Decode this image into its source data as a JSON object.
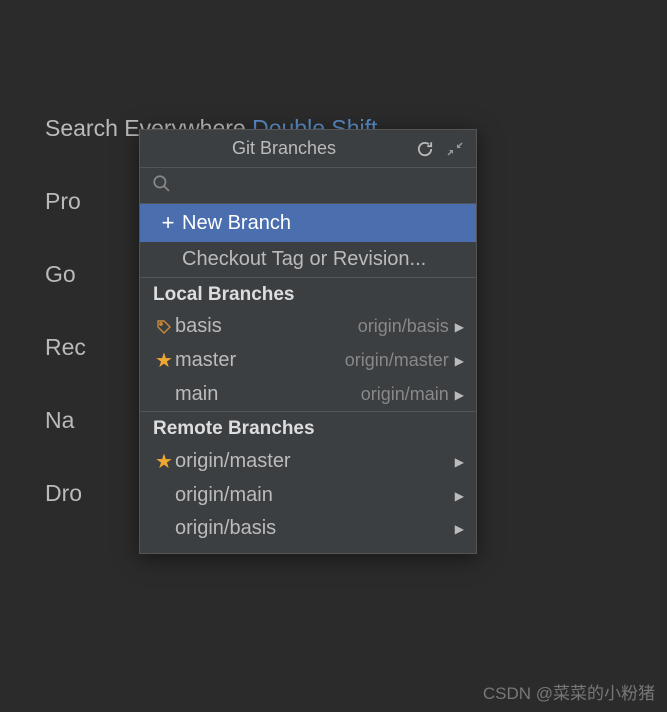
{
  "background": {
    "line1": {
      "text": "Search Everywhere",
      "shortcut": "Double Shift"
    },
    "line2": "Pro",
    "line3": "Go",
    "line4": "Rec",
    "line5": "Na",
    "line6": "Dro"
  },
  "popup": {
    "title": "Git Branches",
    "search_placeholder": "",
    "actions": {
      "new_branch": "New Branch",
      "checkout_tag": "Checkout Tag or Revision..."
    },
    "local_section": "Local Branches",
    "local_branches": [
      {
        "name": "basis",
        "tracking": "origin/basis",
        "icon": "tag"
      },
      {
        "name": "master",
        "tracking": "origin/master",
        "icon": "star"
      },
      {
        "name": "main",
        "tracking": "origin/main",
        "icon": ""
      }
    ],
    "remote_section": "Remote Branches",
    "remote_branches": [
      {
        "name": "origin/master",
        "icon": "star"
      },
      {
        "name": "origin/main",
        "icon": ""
      },
      {
        "name": "origin/basis",
        "icon": ""
      }
    ]
  },
  "watermark": "CSDN @菜菜的小粉猪"
}
